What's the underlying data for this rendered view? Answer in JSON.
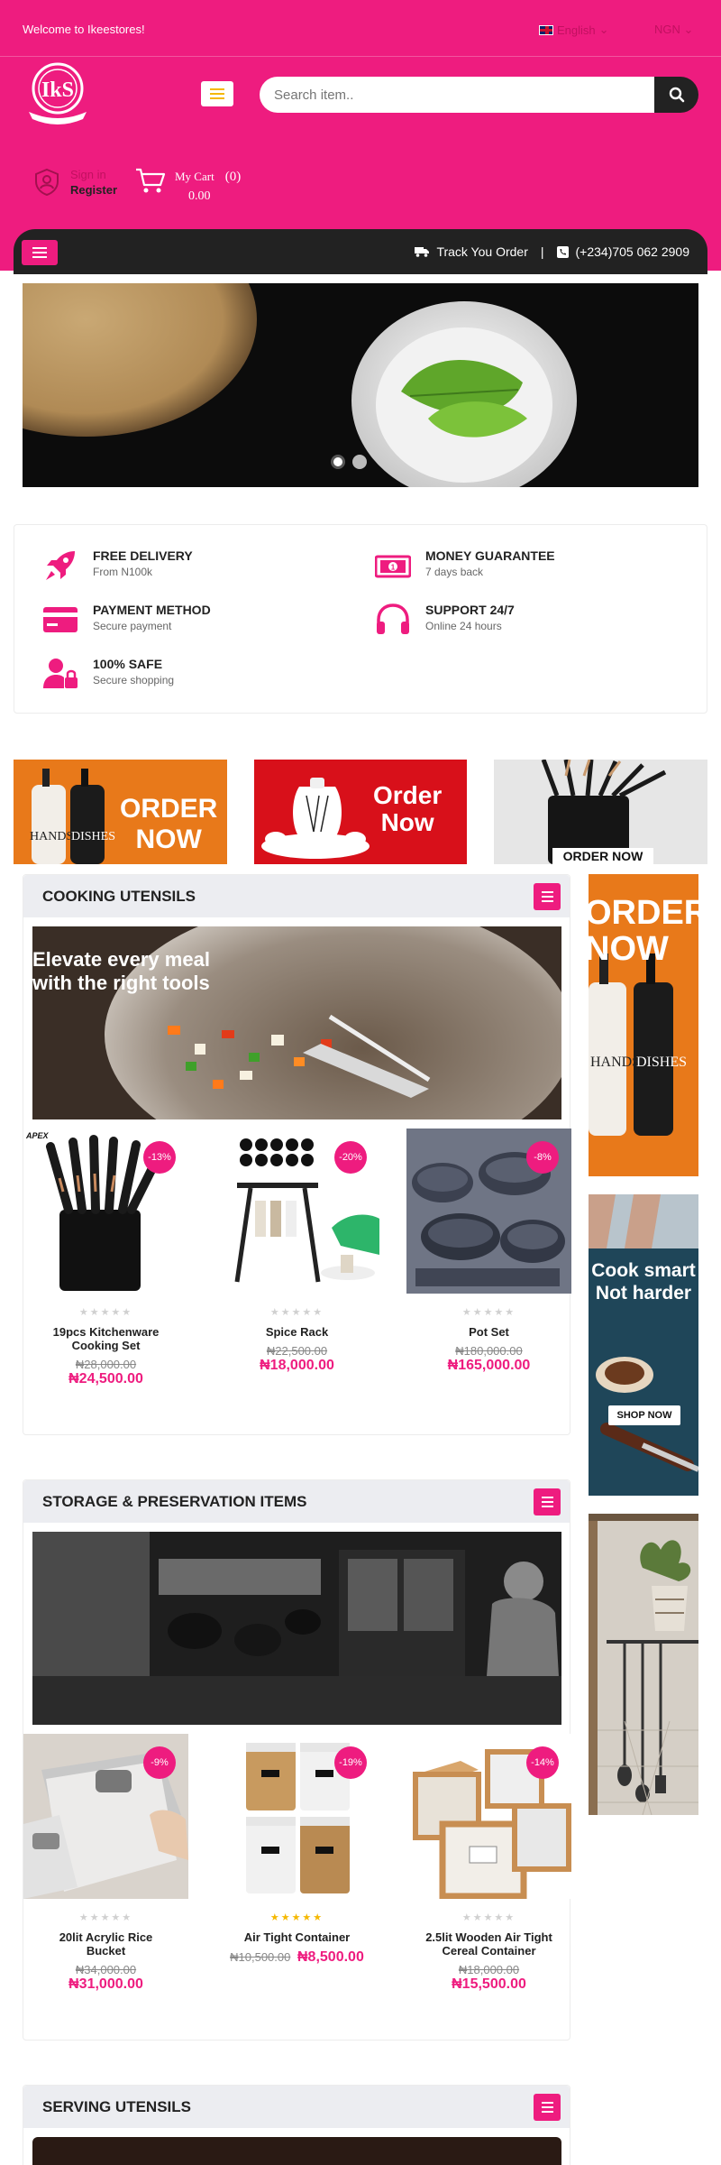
{
  "topbar": {
    "welcome": "Welcome to Ikeestores!",
    "language": "English",
    "currency": "NGN"
  },
  "search": {
    "placeholder": "Search item.."
  },
  "account": {
    "signin": "Sign in",
    "register": "Register"
  },
  "cart": {
    "label": "My  Cart",
    "count": "(0)",
    "total": "0.00"
  },
  "navbar": {
    "track": "Track You Order",
    "separator": "|",
    "phone": "(+234)705 062 2909"
  },
  "features": [
    {
      "title": "FREE DELIVERY",
      "subtitle": "From N100k",
      "icon": "rocket-icon"
    },
    {
      "title": "MONEY GUARANTEE",
      "subtitle": "7 days back",
      "icon": "money-icon"
    },
    {
      "title": "PAYMENT METHOD",
      "subtitle": "Secure payment",
      "icon": "credit-card-icon"
    },
    {
      "title": "SUPPORT 24/7",
      "subtitle": "Online 24 hours",
      "icon": "headphones-icon"
    },
    {
      "title": "100% SAFE",
      "subtitle": "Secure shopping",
      "icon": "user-lock-icon"
    }
  ],
  "promos": [
    {
      "text_line1": "ORDER",
      "text_line2": "NOW",
      "bottle_left": "HANDS",
      "bottle_right": "DISHES"
    },
    {
      "text_line1": "Order",
      "text_line2": "Now"
    },
    {
      "text_line1": "ORDER NOW"
    }
  ],
  "sections": [
    {
      "title": "COOKING UTENSILS",
      "banner_caption_line1": "Elevate every meal",
      "banner_caption_line2": "with the right tools",
      "products": [
        {
          "name": "19pcs Kitchenware Cooking Set",
          "badge": "-13%",
          "old_price": "₦28,000.00",
          "price": "₦24,500.00",
          "brand": "APEX"
        },
        {
          "name": "Spice Rack",
          "badge": "-20%",
          "old_price": "₦22,500.00",
          "price": "₦18,000.00"
        },
        {
          "name": "Pot Set",
          "badge": "-8%",
          "old_price": "₦180,000.00",
          "price": "₦165,000.00"
        }
      ]
    },
    {
      "title": "STORAGE & PRESERVATION ITEMS",
      "products": [
        {
          "name": "20lit Acrylic Rice Bucket",
          "badge": "-9%",
          "old_price": "₦34,000.00",
          "price": "₦31,000.00"
        },
        {
          "name": "Air Tight Container",
          "badge": "-19%",
          "old_price": "₦10,500.00",
          "price": "₦8,500.00"
        },
        {
          "name": "2.5lit Wooden Air Tight Cereal Container",
          "badge": "-14%",
          "old_price": "₦18,000.00",
          "price": "₦15,500.00"
        }
      ]
    },
    {
      "title": "SERVING UTENSILS"
    }
  ],
  "side_ads": [
    {
      "text_line1": "ORDER",
      "text_line2": "NOW",
      "bottle_left": "HANDS",
      "bottle_right": "DISHES"
    },
    {
      "text_line1": "Cook smart",
      "text_line2": "Not harder",
      "button": "SHOP NOW"
    }
  ],
  "colors": {
    "brand": "#ee1c7f",
    "dark": "#222222",
    "accent_yellow": "#f5b800"
  }
}
